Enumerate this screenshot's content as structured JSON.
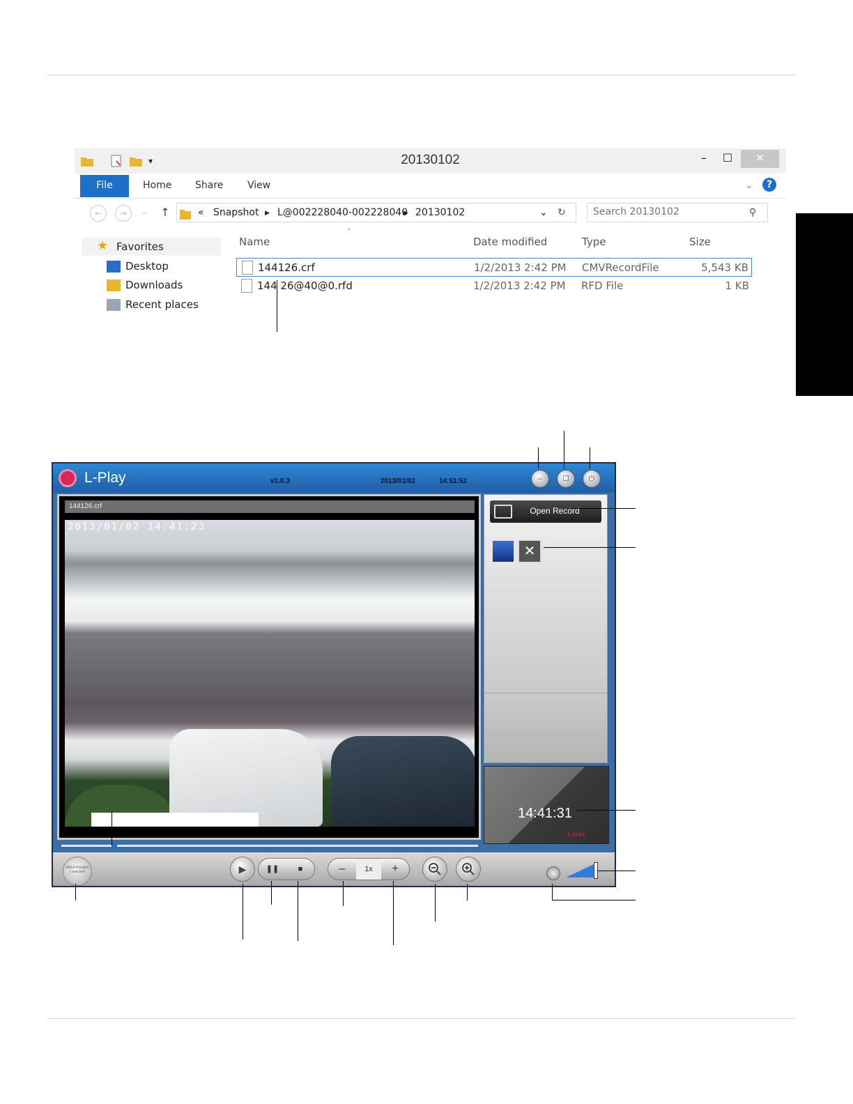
{
  "explorer": {
    "window_title": "20130102",
    "ribbon_tabs": [
      "File",
      "Home",
      "Share",
      "View"
    ],
    "breadcrumb": {
      "prefix": "«",
      "items": [
        "Snapshot",
        "L@002228040-002228040",
        "20130102"
      ]
    },
    "search_placeholder": "Search 20130102",
    "nav": {
      "favorites": "Favorites",
      "items": [
        "Desktop",
        "Downloads",
        "Recent places"
      ]
    },
    "columns": [
      "Name",
      "Date modified",
      "Type",
      "Size"
    ],
    "files": [
      {
        "name": "144126.crf",
        "date": "1/2/2013 2:42 PM",
        "type": "CMVRecordFile",
        "size": "5,543 KB",
        "selected": true
      },
      {
        "name": "144 26@40@0.rfd",
        "date": "1/2/2013 2:42 PM",
        "type": "RFD File",
        "size": "1 KB",
        "selected": false
      }
    ]
  },
  "lplay": {
    "app_name": "L-Play",
    "version": "v1.0.3",
    "date": "2013/01/02",
    "time": "14:51:52",
    "file_label": "144126.crf",
    "video_timestamp": "2013/01/02  14:41:23",
    "open_record_label": "Open Record",
    "playback_time": "14:41:31",
    "brand": "Lorex",
    "speed_label": "1x",
    "lock_text": "AREA Rotation Launched",
    "colors": {
      "header": "#2f88d6",
      "accent": "#2d7ee0",
      "brand": "#cc1b2b"
    }
  }
}
